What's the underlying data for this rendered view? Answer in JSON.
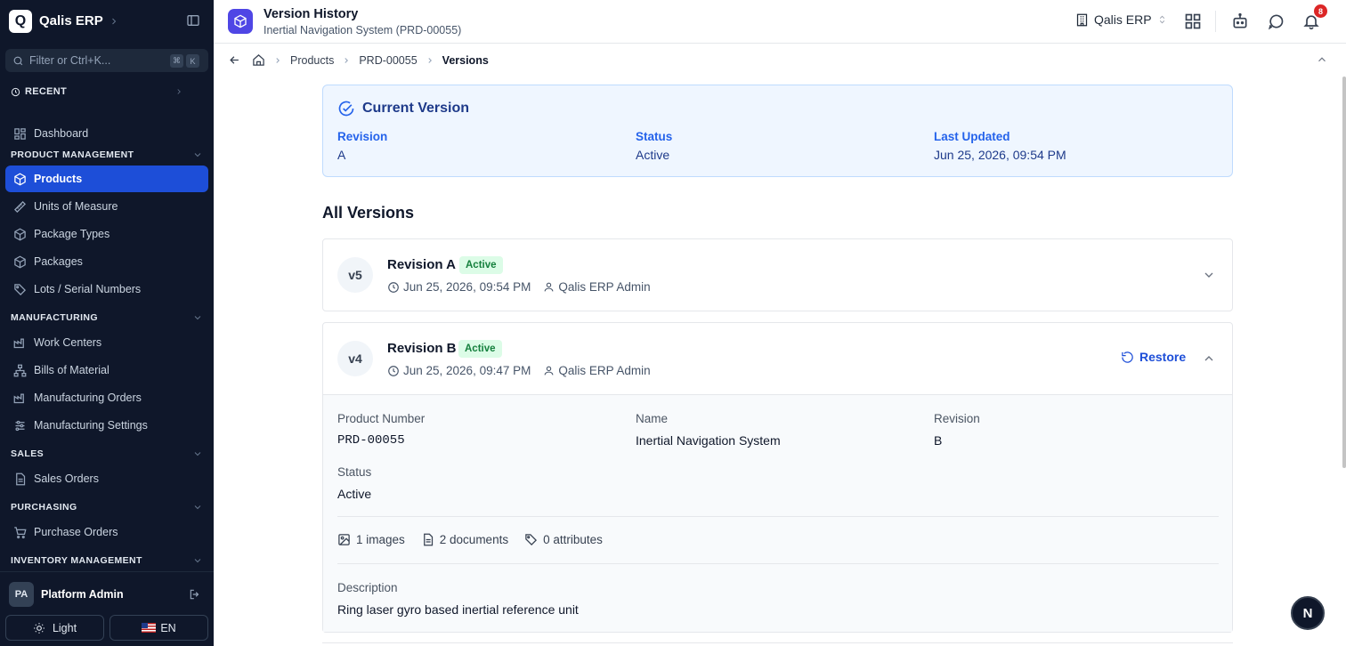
{
  "sidebar": {
    "app_name": "Qalis ERP",
    "logo_letter": "Q",
    "filter_placeholder": "Filter or Ctrl+K...",
    "kbd_1": "⌘",
    "kbd_2": "K",
    "recent_label": "RECENT",
    "dashboard": "Dashboard",
    "sections": {
      "product_management": "PRODUCT MANAGEMENT",
      "manufacturing": "MANUFACTURING",
      "sales": "SALES",
      "purchasing": "PURCHASING",
      "inventory_management": "INVENTORY MANAGEMENT"
    },
    "items": {
      "products": "Products",
      "units_of_measure": "Units of Measure",
      "package_types": "Package Types",
      "packages": "Packages",
      "lots_serial": "Lots / Serial Numbers",
      "work_centers": "Work Centers",
      "bills_of_material": "Bills of Material",
      "manufacturing_orders": "Manufacturing Orders",
      "manufacturing_settings": "Manufacturing Settings",
      "sales_orders": "Sales Orders",
      "purchase_orders": "Purchase Orders"
    },
    "user": {
      "initials": "PA",
      "name": "Platform Admin"
    },
    "theme_label": "Light",
    "lang_label": "EN"
  },
  "header": {
    "title": "Version History",
    "subtitle": "Inertial Navigation System (PRD-00055)",
    "org_name": "Qalis ERP",
    "notification_count": "8"
  },
  "breadcrumb": {
    "products": "Products",
    "product_id": "PRD-00055",
    "current": "Versions"
  },
  "current_version": {
    "title": "Current Version",
    "revision_label": "Revision",
    "revision_value": "A",
    "status_label": "Status",
    "status_value": "Active",
    "updated_label": "Last Updated",
    "updated_value": "Jun 25, 2026, 09:54 PM"
  },
  "all_versions_title": "All Versions",
  "versions": [
    {
      "badge": "v5",
      "name": "Revision A",
      "status": "Active",
      "date": "Jun 25, 2026, 09:54 PM",
      "user": "Qalis ERP Admin"
    },
    {
      "badge": "v4",
      "name": "Revision B",
      "status": "Active",
      "date": "Jun 25, 2026, 09:47 PM",
      "user": "Qalis ERP Admin",
      "restore_label": "Restore",
      "details": {
        "product_number_label": "Product Number",
        "product_number": "PRD-00055",
        "name_label": "Name",
        "name": "Inertial Navigation System",
        "revision_label": "Revision",
        "revision": "B",
        "status_label": "Status",
        "status": "Active",
        "images": "1 images",
        "documents": "2 documents",
        "attributes": "0 attributes",
        "description_label": "Description",
        "description": "Ring laser gyro based inertial reference unit"
      }
    }
  ],
  "floating_button": "N",
  "colors": {
    "sidebar_bg": "#0f172a",
    "accent": "#1d4ed8",
    "active_green": "#15803d",
    "notification_red": "#dc2626"
  }
}
